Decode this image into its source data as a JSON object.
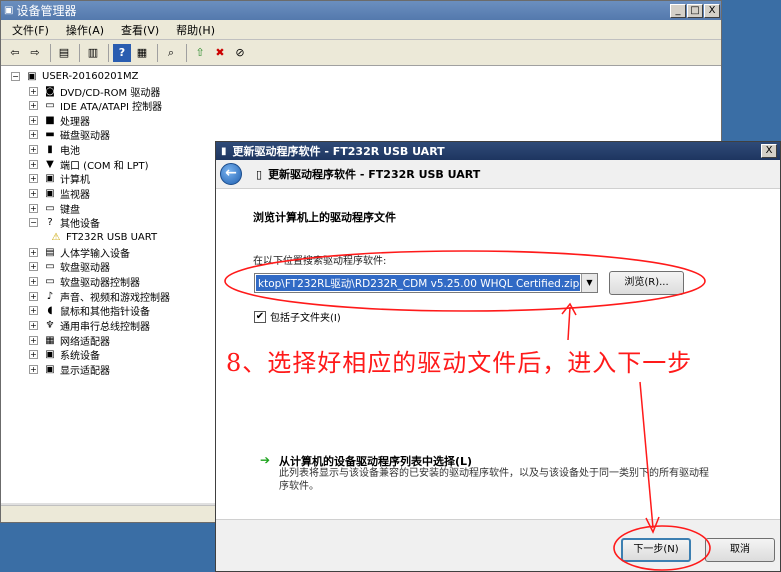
{
  "device_manager": {
    "title": "设备管理器",
    "win_buttons": [
      "_",
      "□",
      "X"
    ],
    "menu": [
      "文件(F)",
      "操作(A)",
      "查看(V)",
      "帮助(H)"
    ],
    "toolbar_icons": [
      "back-icon",
      "forward-icon",
      "properties-icon",
      "list-icon",
      "help-icon",
      "console-icon",
      "scan-icon",
      "update-driver-icon",
      "uninstall-icon",
      "disable-icon"
    ],
    "tree": {
      "root": "USER-20160201MZ",
      "items": [
        {
          "label": "DVD/CD-ROM 驱动器",
          "exp": "+",
          "icon": "dvd-drive-icon",
          "glyph": "◙"
        },
        {
          "label": "IDE ATA/ATAPI 控制器",
          "exp": "+",
          "icon": "ide-controller-icon",
          "glyph": "▭"
        },
        {
          "label": "处理器",
          "exp": "+",
          "icon": "processor-icon",
          "glyph": "■"
        },
        {
          "label": "磁盘驱动器",
          "exp": "+",
          "icon": "disk-drive-icon",
          "glyph": "▬"
        },
        {
          "label": "电池",
          "exp": "+",
          "icon": "battery-icon",
          "glyph": "▮"
        },
        {
          "label": "端口 (COM 和 LPT)",
          "exp": "+",
          "icon": "port-icon",
          "glyph": "▼"
        },
        {
          "label": "计算机",
          "exp": "+",
          "icon": "computer-icon",
          "glyph": "▣"
        },
        {
          "label": "监视器",
          "exp": "+",
          "icon": "monitor-icon",
          "glyph": "▣"
        },
        {
          "label": "键盘",
          "exp": "+",
          "icon": "keyboard-icon",
          "glyph": "▭"
        },
        {
          "label": "其他设备",
          "exp": "−",
          "icon": "other-devices-icon",
          "glyph": "?"
        },
        {
          "label": "FT232R USB UART",
          "exp": "",
          "icon": "warning-device-icon",
          "glyph": "⚠",
          "child": true
        },
        {
          "label": "人体学输入设备",
          "exp": "+",
          "icon": "hid-icon",
          "glyph": "▤"
        },
        {
          "label": "软盘驱动器",
          "exp": "+",
          "icon": "floppy-drive-icon",
          "glyph": "▭"
        },
        {
          "label": "软盘驱动器控制器",
          "exp": "+",
          "icon": "floppy-controller-icon",
          "glyph": "▭"
        },
        {
          "label": "声音、视频和游戏控制器",
          "exp": "+",
          "icon": "sound-icon",
          "glyph": "♪"
        },
        {
          "label": "鼠标和其他指针设备",
          "exp": "+",
          "icon": "mouse-icon",
          "glyph": "◖"
        },
        {
          "label": "通用串行总线控制器",
          "exp": "+",
          "icon": "usb-icon",
          "glyph": "♆"
        },
        {
          "label": "网络适配器",
          "exp": "+",
          "icon": "network-icon",
          "glyph": "▦"
        },
        {
          "label": "系统设备",
          "exp": "+",
          "icon": "system-device-icon",
          "glyph": "▣"
        },
        {
          "label": "显示适配器",
          "exp": "+",
          "icon": "display-adapter-icon",
          "glyph": "▣"
        }
      ]
    }
  },
  "dialog": {
    "title": "更新驱动程序软件 - FT232R USB UART",
    "close": "X",
    "header_text": "更新驱动程序软件 - FT232R USB UART",
    "heading": "浏览计算机上的驱动程序文件",
    "search_label": "在以下位置搜索驱动程序软件:",
    "path_value": "ktop\\FT232RL驱动\\RD232R_CDM v5.25.00 WHQL Certified.zip",
    "browse_label": "浏览(R)...",
    "include_subfolders_label": "包括子文件夹(I)",
    "include_subfolders_checked": true,
    "pick_title": "从计算机的设备驱动程序列表中选择(L)",
    "pick_desc": "此列表将显示与该设备兼容的已安装的驱动程序软件，以及与该设备处于同一类别下的所有驱动程序软件。",
    "next_label": "下一步(N)",
    "cancel_label": "取消"
  },
  "annotation": {
    "text": "8、选择好相应的驱动文件后，进入下一步",
    "color": "#ff1a1a"
  }
}
